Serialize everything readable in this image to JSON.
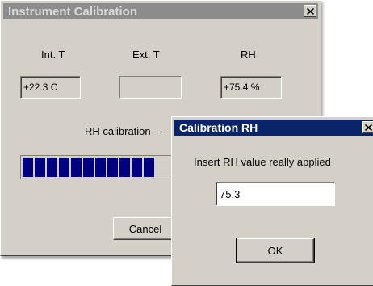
{
  "main_window": {
    "title": "Instrument Calibration",
    "labels": {
      "int_t": "Int. T",
      "ext_t": "Ext. T",
      "rh": "RH"
    },
    "fields": {
      "int_t": "+22.3 C",
      "ext_t": "",
      "rh": "+75.4 %"
    },
    "status": "RH calibration   -",
    "progress_segments": 11,
    "cancel_label": "Cancel"
  },
  "dialog": {
    "title": "Calibration RH",
    "prompt": "Insert RH value really applied",
    "input_value": "75.3",
    "ok_label": "OK"
  },
  "icons": {
    "close": "close-icon"
  },
  "colors": {
    "active_title": "#0a246a",
    "inactive_title": "#8c8c8c",
    "progress": "#000080",
    "face": "#d4d0c8"
  }
}
